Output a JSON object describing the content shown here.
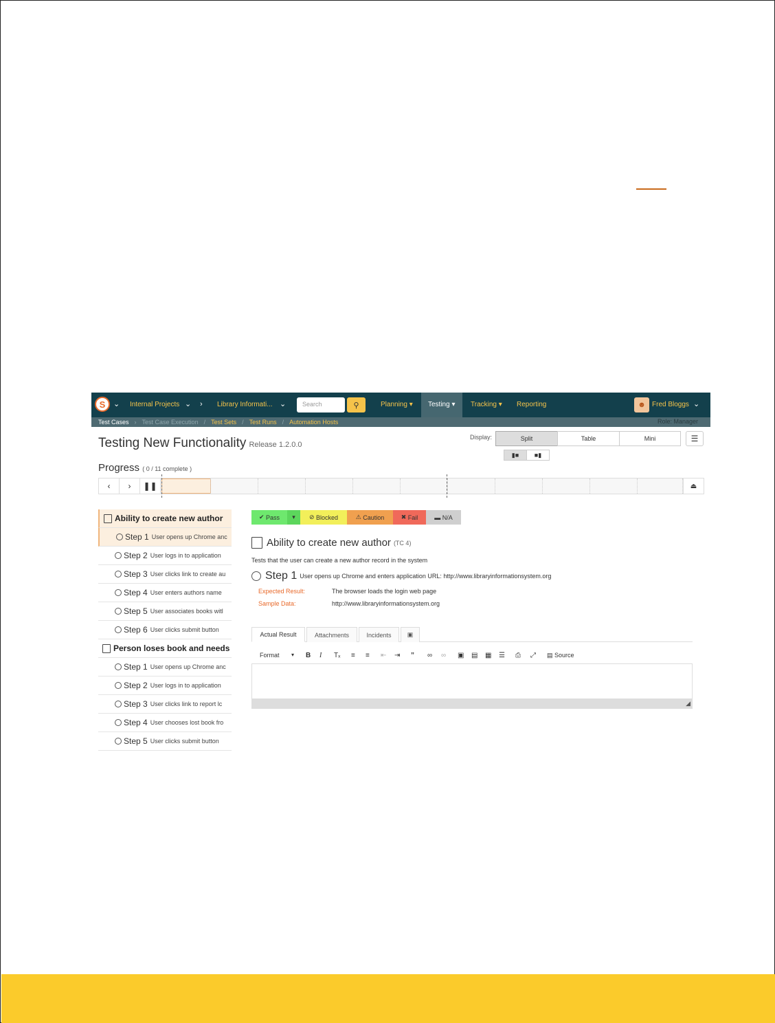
{
  "nav": {
    "logo_letter": "S",
    "projects_label": "Internal Projects",
    "product_label": "Library Informati...",
    "search_placeholder": "Search",
    "tabs": [
      "Planning",
      "Testing",
      "Tracking",
      "Reporting"
    ],
    "user_name": "Fred Bloggs"
  },
  "breadcrumbs": {
    "items": [
      "Test Cases",
      "Test Case Execution",
      "Test Sets",
      "Test Runs",
      "Automation Hosts"
    ],
    "role": "Role: Manager"
  },
  "page": {
    "title": "Testing New Functionality",
    "release": "Release 1.2.0.0"
  },
  "display": {
    "label": "Display:",
    "options": [
      "Split",
      "Table",
      "Mini"
    ],
    "selected": "Split"
  },
  "progress": {
    "label": "Progress",
    "completed": "0",
    "total": "11 complete",
    "summary": "( 0 / 11 complete )"
  },
  "test_list": [
    {
      "type": "case",
      "label": "Ability to create new author",
      "selected": true
    },
    {
      "type": "step",
      "step": "Step 1",
      "desc": "User opens up Chrome anc",
      "selected": true
    },
    {
      "type": "step",
      "step": "Step 2",
      "desc": "User logs in to application"
    },
    {
      "type": "step",
      "step": "Step 3",
      "desc": "User clicks link to create au"
    },
    {
      "type": "step",
      "step": "Step 4",
      "desc": "User enters authors name"
    },
    {
      "type": "step",
      "step": "Step 5",
      "desc": "User associates books witl"
    },
    {
      "type": "step",
      "step": "Step 6",
      "desc": "User clicks submit button"
    },
    {
      "type": "case",
      "label": "Person loses book and needs t"
    },
    {
      "type": "step",
      "step": "Step 1",
      "desc": "User opens up Chrome anc"
    },
    {
      "type": "step",
      "step": "Step 2",
      "desc": "User logs in to application"
    },
    {
      "type": "step",
      "step": "Step 3",
      "desc": "User clicks link to report lc"
    },
    {
      "type": "step",
      "step": "Step 4",
      "desc": "User chooses lost book fro"
    },
    {
      "type": "step",
      "step": "Step 5",
      "desc": "User clicks submit button"
    }
  ],
  "status_buttons": {
    "pass": "Pass",
    "blocked": "Blocked",
    "caution": "Caution",
    "fail": "Fail",
    "na": "N/A"
  },
  "colors": {
    "nav_bg": "#13404c",
    "accent": "#f5c34a",
    "pass": "#6ee86e",
    "blocked": "#f2ef5a",
    "caution": "#f0a04f",
    "fail": "#f0695a",
    "na": "#cfcfcf",
    "footer": "#fbcb2b"
  },
  "detail": {
    "case_title": "Ability to create new author",
    "case_id": "(TC 4)",
    "description": "Tests that the user can create a new author record in the system",
    "step_label": "Step 1",
    "step_desc": "User opens up Chrome and enters application URL: http://www.libraryinformationsystem.org",
    "expected_key": "Expected Result:",
    "expected_val": "The browser loads the login web page",
    "sample_key": "Sample Data:",
    "sample_val": "http://www.libraryinformationsystem.org"
  },
  "result_tabs": [
    "Actual Result",
    "Attachments",
    "Incidents"
  ],
  "editor": {
    "format_label": "Format",
    "source_label": "Source"
  }
}
